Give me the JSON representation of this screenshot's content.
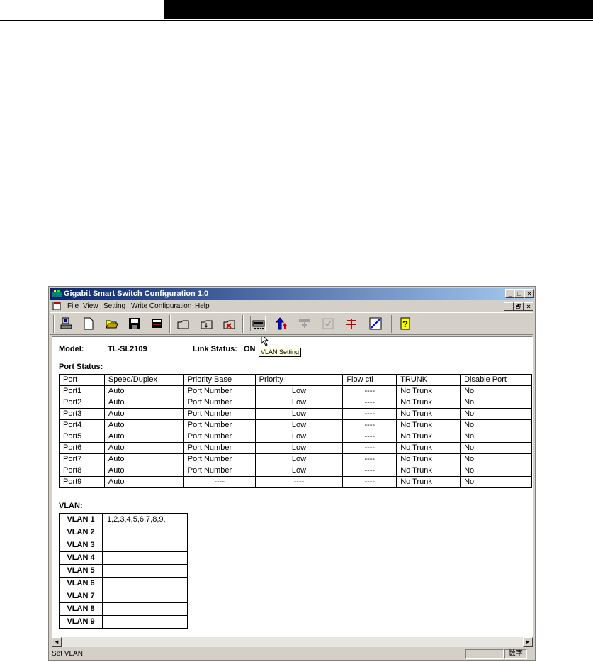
{
  "window": {
    "title": "Gigabit Smart Switch Configuration 1.0",
    "controls": {
      "minimize": "_",
      "maximize": "□",
      "close": "×",
      "restore": "🗗"
    }
  },
  "menu": [
    "File",
    "View",
    "Setting",
    "Write Configuration",
    "Help"
  ],
  "menu_underline": [
    "F",
    "V",
    "S",
    "C",
    "H"
  ],
  "toolbar": {
    "buttons": [
      "connect-icon",
      "new-file-icon",
      "open-folder-icon",
      "save-icon",
      "save-as-icon",
      "upload-icon",
      "download-icon",
      "delete-icon",
      "vlan-setting-icon",
      "priority-icon",
      "trunk-icon",
      "port-disable-icon",
      "flow-control-icon",
      "edit-icon",
      "help-icon"
    ],
    "tooltip": "VLAN Setting",
    "colors": {
      "accent": "#0a246a",
      "face": "#d4d0c8"
    }
  },
  "device": {
    "model_label": "Model:",
    "model_value": "TL-SL2109",
    "link_label": "Link Status:",
    "link_value": "ON"
  },
  "port_status": {
    "title": "Port Status:",
    "headers": [
      "Port",
      "Speed/Duplex",
      "Priority Base",
      "Priority",
      "Flow ctl",
      "TRUNK",
      "Disable Port"
    ],
    "rows": [
      [
        "Port1",
        "Auto",
        "Port Number",
        "Low",
        "----",
        "No Trunk",
        "No"
      ],
      [
        "Port2",
        "Auto",
        "Port Number",
        "Low",
        "----",
        "No Trunk",
        "No"
      ],
      [
        "Port3",
        "Auto",
        "Port Number",
        "Low",
        "----",
        "No Trunk",
        "No"
      ],
      [
        "Port4",
        "Auto",
        "Port Number",
        "Low",
        "----",
        "No Trunk",
        "No"
      ],
      [
        "Port5",
        "Auto",
        "Port Number",
        "Low",
        "----",
        "No Trunk",
        "No"
      ],
      [
        "Port6",
        "Auto",
        "Port Number",
        "Low",
        "----",
        "No Trunk",
        "No"
      ],
      [
        "Port7",
        "Auto",
        "Port Number",
        "Low",
        "----",
        "No Trunk",
        "No"
      ],
      [
        "Port8",
        "Auto",
        "Port Number",
        "Low",
        "----",
        "No Trunk",
        "No"
      ],
      [
        "Port9",
        "Auto",
        "----",
        "----",
        "----",
        "No Trunk",
        "No"
      ]
    ]
  },
  "vlan": {
    "title": "VLAN:",
    "rows": [
      [
        "VLAN 1",
        "1,2,3,4,5,6,7,8,9,"
      ],
      [
        "VLAN 2",
        ""
      ],
      [
        "VLAN 3",
        ""
      ],
      [
        "VLAN 4",
        ""
      ],
      [
        "VLAN 5",
        ""
      ],
      [
        "VLAN 6",
        ""
      ],
      [
        "VLAN 7",
        ""
      ],
      [
        "VLAN 8",
        ""
      ],
      [
        "VLAN 9",
        ""
      ]
    ]
  },
  "scroll": {
    "left": "◄",
    "right": "►"
  },
  "status": {
    "text": "Set VLAN",
    "ime": "数字"
  }
}
